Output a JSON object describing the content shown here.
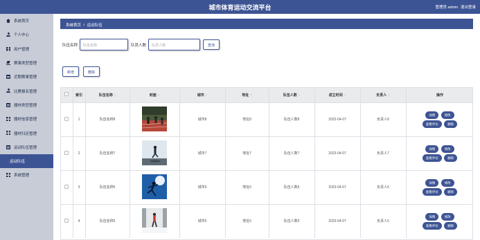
{
  "header": {
    "title": "城市体育运动交流平台",
    "user_label": "管理员 admin",
    "logout_label": "退出登录"
  },
  "sidebar": {
    "items": [
      {
        "label": "系统首页",
        "icon": "home-icon"
      },
      {
        "label": "个人中心",
        "icon": "person-icon"
      },
      {
        "label": "用户管理",
        "icon": "grid-icon"
      },
      {
        "label": "赛事类型管理",
        "icon": "edit-icon"
      },
      {
        "label": "近期赛事管理",
        "icon": "doc-icon"
      },
      {
        "label": "比赛报名管理",
        "icon": "person-icon"
      },
      {
        "label": "器材类型管理",
        "icon": "doc-icon"
      },
      {
        "label": "器材信息管理",
        "icon": "grid-icon"
      },
      {
        "label": "器材归还管理",
        "icon": "grid-icon"
      },
      {
        "label": "运动队伍管理",
        "icon": "doc-icon"
      },
      {
        "label": "运动队伍",
        "icon": ""
      },
      {
        "label": "系统管理",
        "icon": "grid-icon"
      }
    ],
    "active_index": 10
  },
  "breadcrumb": {
    "home": "系统首页",
    "separator": "/",
    "current": "运动队伍"
  },
  "search": {
    "name_label": "队伍名称",
    "name_placeholder": "队伍名称",
    "people_label": "队员人数",
    "people_placeholder": "队员人数",
    "query_button": "查询"
  },
  "actions": {
    "add_button": "新增",
    "delete_button": "删除"
  },
  "table": {
    "columns": [
      "索引",
      "队伍名称",
      "封面",
      "城市",
      "地址",
      "队伍人数",
      "成立时间",
      "负责人",
      "操作"
    ],
    "row_buttons": {
      "detail": "详情",
      "edit": "修改",
      "comments": "查看评论",
      "delete": "删除"
    },
    "rows": [
      {
        "index": "1",
        "name": "队伍名称8",
        "city": "城市8",
        "address": "地址8",
        "people": "队伍人数8",
        "date": "2023-04-07",
        "leader": "负责人8",
        "cover": "running-track"
      },
      {
        "index": "2",
        "name": "队伍名称7",
        "city": "城市7",
        "address": "地址7",
        "people": "队伍人数7",
        "date": "2023-04-07",
        "leader": "负责人7",
        "cover": "runner-sky"
      },
      {
        "index": "3",
        "name": "队伍名称6",
        "city": "城市6",
        "address": "地址6",
        "people": "队伍人数6",
        "date": "2023-04-07",
        "leader": "负责人6",
        "cover": "sprinter-blue"
      },
      {
        "index": "4",
        "name": "队伍名称5",
        "city": "城市5",
        "address": "地址5",
        "people": "队伍人数5",
        "date": "2023-04-07",
        "leader": "负责人5",
        "cover": "runner-snow"
      }
    ]
  },
  "colors": {
    "primary": "#3d5494",
    "sidebar_bg": "#c8ccd7"
  }
}
